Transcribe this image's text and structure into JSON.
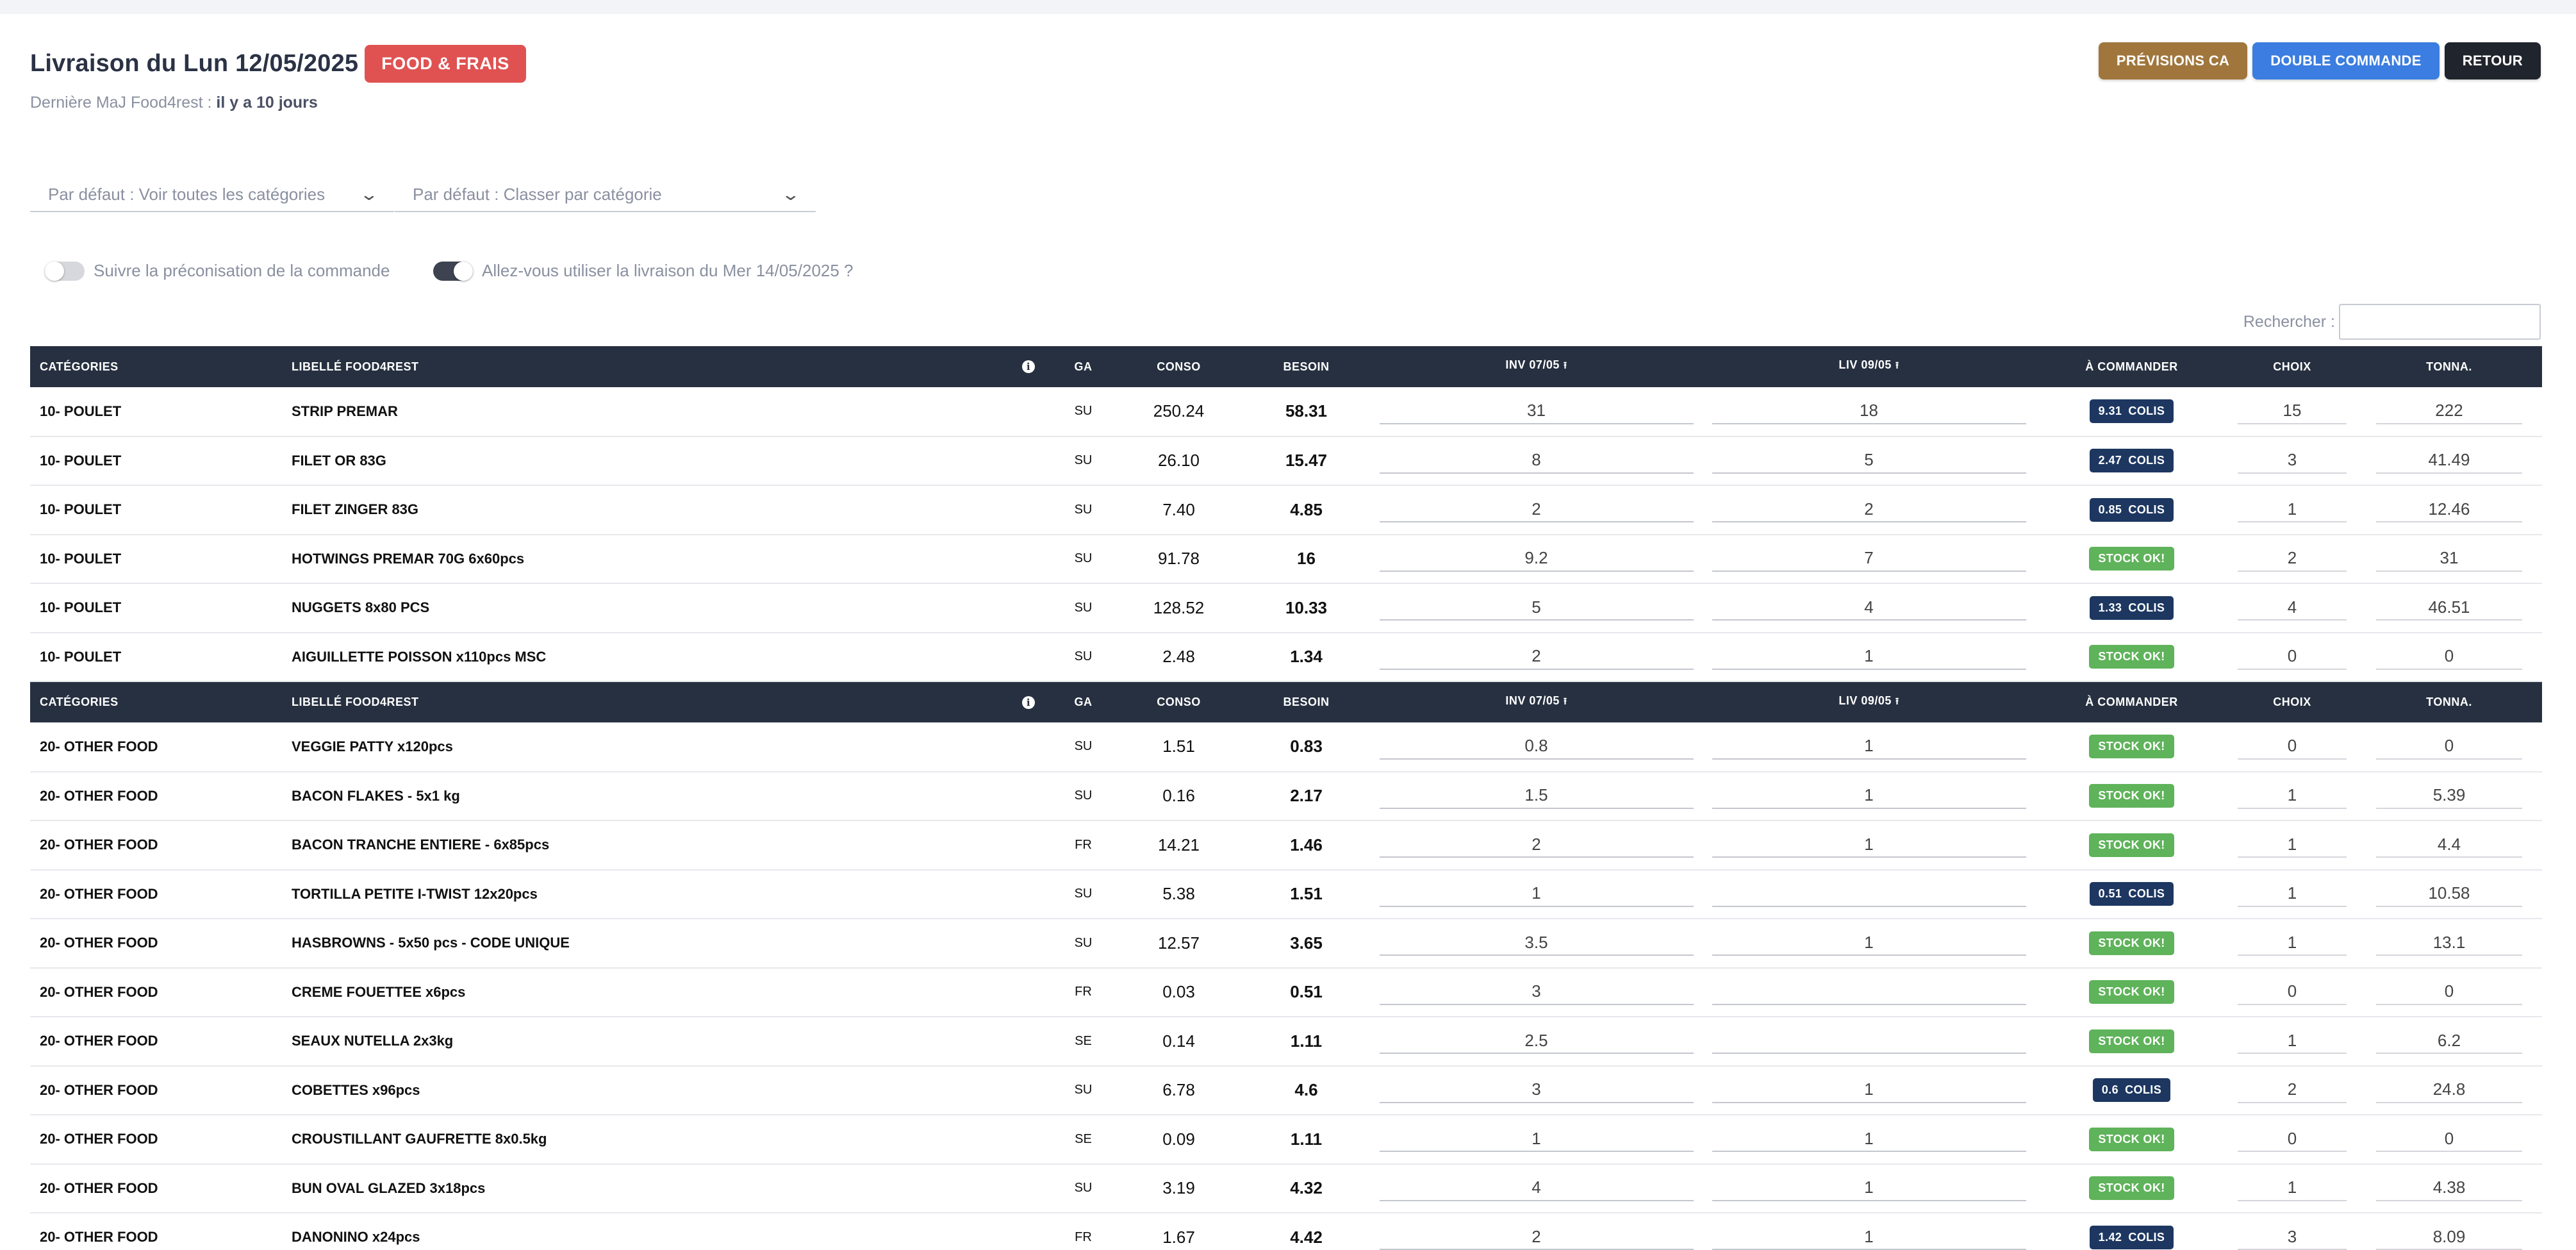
{
  "header": {
    "title": "Livraison du Lun 12/05/2025",
    "badge": "FOOD & FRAIS",
    "subtitle_prefix": "Dernière MaJ Food4rest :",
    "subtitle_value": "il y a 10 jours"
  },
  "actions": {
    "previsions": "PRÉVISIONS CA",
    "double": "DOUBLE COMMANDE",
    "retour": "RETOUR"
  },
  "filters": {
    "category": "Par défaut : Voir toutes les catégories",
    "sort": "Par défaut : Classer par catégorie"
  },
  "toggles": {
    "preconisation": {
      "label": "Suivre la préconisation de la commande",
      "on": false
    },
    "livraison": {
      "label": "Allez-vous utiliser la livraison du Mer 14/05/2025 ?",
      "on": true
    }
  },
  "search": {
    "label": "Rechercher :",
    "value": ""
  },
  "columns": [
    "CATÉGORIES",
    "LIBELLÉ FOOD4REST",
    "GA",
    "CONSO",
    "BESOIN",
    "INV 07/05",
    "LIV 09/05",
    "À COMMANDER",
    "CHOIX",
    "TONNA."
  ],
  "colors": {
    "header": "#263040",
    "colis": "#1d3761",
    "stock_ok": "#5fb35a",
    "badge": "#e05252"
  },
  "icons": {
    "info": "info-icon",
    "sort": "sort-arrow-icon",
    "chevron": "chevron-down-icon"
  },
  "groups": [
    {
      "rows": [
        {
          "cat": "10- POULET",
          "lib": "STRIP PREMAR",
          "ga": "SU",
          "conso": "250.24",
          "besoin": "58.31",
          "inv": "31",
          "liv": "18",
          "cmd_type": "colis",
          "cmd_val": "9.31",
          "cmd_unit": "COLIS",
          "choix": "15",
          "tonna": "222"
        },
        {
          "cat": "10- POULET",
          "lib": "FILET OR 83G",
          "ga": "SU",
          "conso": "26.10",
          "besoin": "15.47",
          "inv": "8",
          "liv": "5",
          "cmd_type": "colis",
          "cmd_val": "2.47",
          "cmd_unit": "COLIS",
          "choix": "3",
          "tonna": "41.49"
        },
        {
          "cat": "10- POULET",
          "lib": "FILET ZINGER 83G",
          "ga": "SU",
          "conso": "7.40",
          "besoin": "4.85",
          "inv": "2",
          "liv": "2",
          "cmd_type": "colis",
          "cmd_val": "0.85",
          "cmd_unit": "COLIS",
          "choix": "1",
          "tonna": "12.46"
        },
        {
          "cat": "10- POULET",
          "lib": "HOTWINGS PREMAR 70G 6x60pcs",
          "ga": "SU",
          "conso": "91.78",
          "besoin": "16",
          "inv": "9.2",
          "liv": "7",
          "cmd_type": "ok",
          "cmd_val": "STOCK OK!",
          "cmd_unit": "",
          "choix": "2",
          "tonna": "31"
        },
        {
          "cat": "10- POULET",
          "lib": "NUGGETS 8x80 PCS",
          "ga": "SU",
          "conso": "128.52",
          "besoin": "10.33",
          "inv": "5",
          "liv": "4",
          "cmd_type": "colis",
          "cmd_val": "1.33",
          "cmd_unit": "COLIS",
          "choix": "4",
          "tonna": "46.51"
        },
        {
          "cat": "10- POULET",
          "lib": "AIGUILLETTE POISSON x110pcs MSC",
          "ga": "SU",
          "conso": "2.48",
          "besoin": "1.34",
          "inv": "2",
          "liv": "1",
          "cmd_type": "ok",
          "cmd_val": "STOCK OK!",
          "cmd_unit": "",
          "choix": "0",
          "tonna": "0"
        }
      ]
    },
    {
      "rows": [
        {
          "cat": "20- OTHER FOOD",
          "lib": "VEGGIE PATTY x120pcs",
          "ga": "SU",
          "conso": "1.51",
          "besoin": "0.83",
          "inv": "0.8",
          "liv": "1",
          "cmd_type": "ok",
          "cmd_val": "STOCK OK!",
          "cmd_unit": "",
          "choix": "0",
          "tonna": "0"
        },
        {
          "cat": "20- OTHER FOOD",
          "lib": "BACON FLAKES - 5x1 kg",
          "ga": "SU",
          "conso": "0.16",
          "besoin": "2.17",
          "inv": "1.5",
          "liv": "1",
          "cmd_type": "ok",
          "cmd_val": "STOCK OK!",
          "cmd_unit": "",
          "choix": "1",
          "tonna": "5.39"
        },
        {
          "cat": "20- OTHER FOOD",
          "lib": "BACON TRANCHE ENTIERE - 6x85pcs",
          "ga": "FR",
          "conso": "14.21",
          "besoin": "1.46",
          "inv": "2",
          "liv": "1",
          "cmd_type": "ok",
          "cmd_val": "STOCK OK!",
          "cmd_unit": "",
          "choix": "1",
          "tonna": "4.4"
        },
        {
          "cat": "20- OTHER FOOD",
          "lib": "TORTILLA PETITE I-TWIST 12x20pcs",
          "ga": "SU",
          "conso": "5.38",
          "besoin": "1.51",
          "inv": "1",
          "liv": "",
          "cmd_type": "colis",
          "cmd_val": "0.51",
          "cmd_unit": "COLIS",
          "choix": "1",
          "tonna": "10.58"
        },
        {
          "cat": "20- OTHER FOOD",
          "lib": "HASBROWNS - 5x50 pcs - CODE UNIQUE",
          "ga": "SU",
          "conso": "12.57",
          "besoin": "3.65",
          "inv": "3.5",
          "liv": "1",
          "cmd_type": "ok",
          "cmd_val": "STOCK OK!",
          "cmd_unit": "",
          "choix": "1",
          "tonna": "13.1"
        },
        {
          "cat": "20- OTHER FOOD",
          "lib": "CREME FOUETTEE x6pcs",
          "ga": "FR",
          "conso": "0.03",
          "besoin": "0.51",
          "inv": "3",
          "liv": "",
          "cmd_type": "ok",
          "cmd_val": "STOCK OK!",
          "cmd_unit": "",
          "choix": "0",
          "tonna": "0"
        },
        {
          "cat": "20- OTHER FOOD",
          "lib": "SEAUX NUTELLA 2x3kg",
          "ga": "SE",
          "conso": "0.14",
          "besoin": "1.11",
          "inv": "2.5",
          "liv": "",
          "cmd_type": "ok",
          "cmd_val": "STOCK OK!",
          "cmd_unit": "",
          "choix": "1",
          "tonna": "6.2"
        },
        {
          "cat": "20- OTHER FOOD",
          "lib": "COBETTES x96pcs",
          "ga": "SU",
          "conso": "6.78",
          "besoin": "4.6",
          "inv": "3",
          "liv": "1",
          "cmd_type": "colis",
          "cmd_val": "0.6",
          "cmd_unit": "COLIS",
          "choix": "2",
          "tonna": "24.8"
        },
        {
          "cat": "20- OTHER FOOD",
          "lib": "CROUSTILLANT GAUFRETTE 8x0.5kg",
          "ga": "SE",
          "conso": "0.09",
          "besoin": "1.11",
          "inv": "1",
          "liv": "1",
          "cmd_type": "ok",
          "cmd_val": "STOCK OK!",
          "cmd_unit": "",
          "choix": "0",
          "tonna": "0"
        },
        {
          "cat": "20- OTHER FOOD",
          "lib": "BUN OVAL GLAZED 3x18pcs",
          "ga": "SU",
          "conso": "3.19",
          "besoin": "4.32",
          "inv": "4",
          "liv": "1",
          "cmd_type": "ok",
          "cmd_val": "STOCK OK!",
          "cmd_unit": "",
          "choix": "1",
          "tonna": "4.38"
        },
        {
          "cat": "20- OTHER FOOD",
          "lib": "DANONINO x24pcs",
          "ga": "FR",
          "conso": "1.67",
          "besoin": "4.42",
          "inv": "2",
          "liv": "1",
          "cmd_type": "colis",
          "cmd_val": "1.42",
          "cmd_unit": "COLIS",
          "choix": "3",
          "tonna": "8.09"
        }
      ]
    }
  ]
}
